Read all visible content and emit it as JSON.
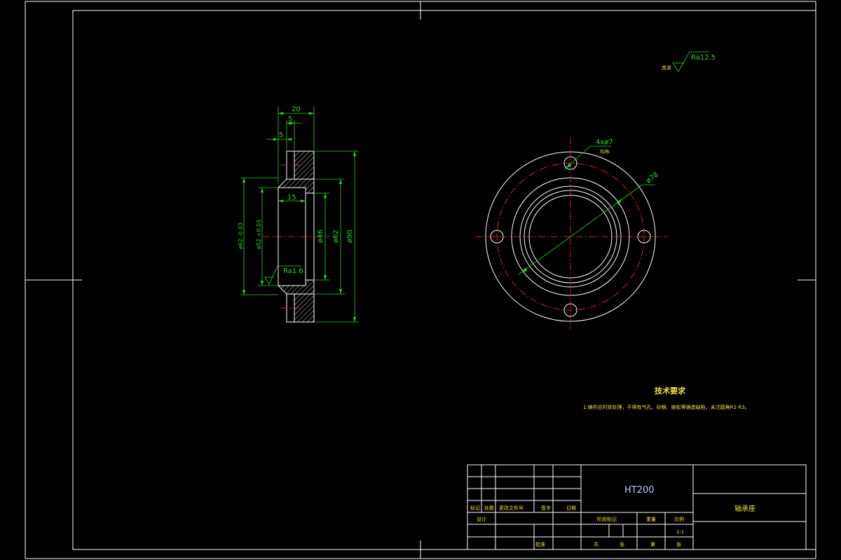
{
  "section_view": {
    "dims": {
      "width_total": "20",
      "step_1": "5",
      "step_2": "5",
      "bore_depth": "15",
      "dia_bore": "ø46",
      "dia_step": "ø62",
      "dia_outer": "ø90",
      "dia_pilot": "ø62 -0.03",
      "dia_seat": "ø52 +0.03"
    },
    "roughness": "Ra1.6"
  },
  "front_view": {
    "holes_label": "4xø7",
    "holes_note": "均布",
    "pcd_label": "ø78"
  },
  "roughness_general": {
    "prefix": "其余",
    "value": "Ra12.5"
  },
  "tech_requirements": {
    "title": "技术要求",
    "line1": "1.铸件应时效处理，不得有气孔、砂眼、缩松等铸造缺陷，未注圆角R2-R3。"
  },
  "title_block": {
    "material": "HT200",
    "part_name": "轴承座",
    "scale_value": "1:1",
    "labels": {
      "mark": "标记",
      "count": "处数",
      "change_doc": "更改文件号",
      "signature": "签字",
      "date": "日期",
      "design": "设计",
      "stage_mark": "阶段标记",
      "weight": "重量",
      "scale": "比例",
      "sheet_total": "共",
      "sheet": "张",
      "sheet_no": "第",
      "sheet2": "张",
      "approve": "批准"
    }
  }
}
